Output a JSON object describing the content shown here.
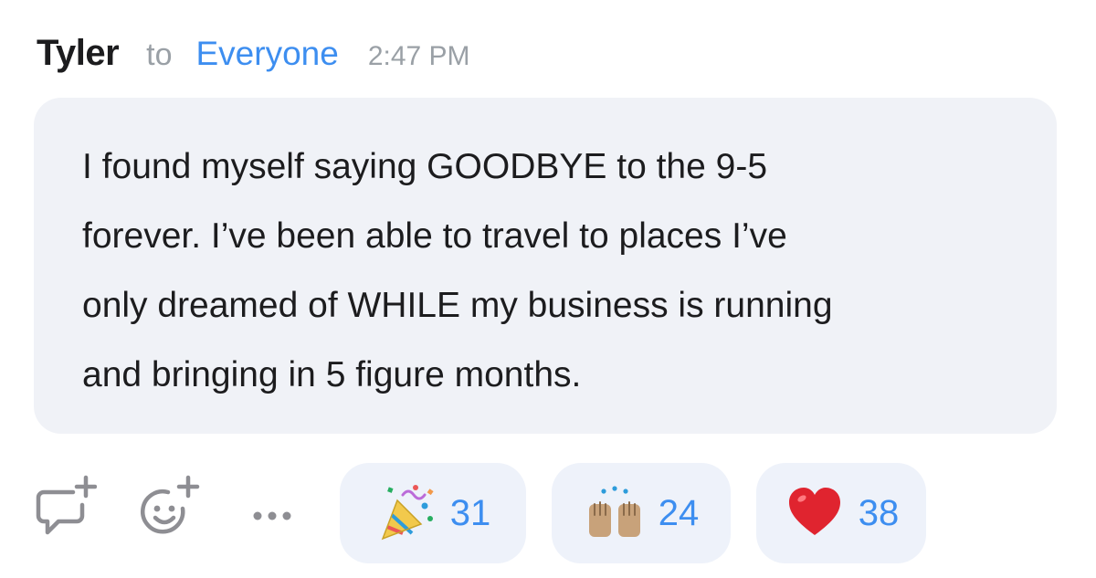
{
  "message": {
    "sender": "Tyler",
    "to_word": "to",
    "recipient": "Everyone",
    "time": "2:47 PM",
    "text": "I found myself saying GOODBYE to the 9-5\nforever. I’ve been able to travel to places I’ve\nonly dreamed of WHILE my business is running\nand bringing in 5 figure months."
  },
  "actions": {
    "reply_icon": "add-comment-icon",
    "react_icon": "add-reaction-icon",
    "more_icon": "more-icon"
  },
  "reactions": [
    {
      "emoji": "party-popper",
      "count": "31"
    },
    {
      "emoji": "raised-hands",
      "count": "24"
    },
    {
      "emoji": "red-heart",
      "count": "38"
    }
  ],
  "colors": {
    "accent": "#3d8ef0",
    "bubble": "#f0f2f7",
    "muted": "#9aa0a6",
    "text": "#1c1c1e"
  }
}
